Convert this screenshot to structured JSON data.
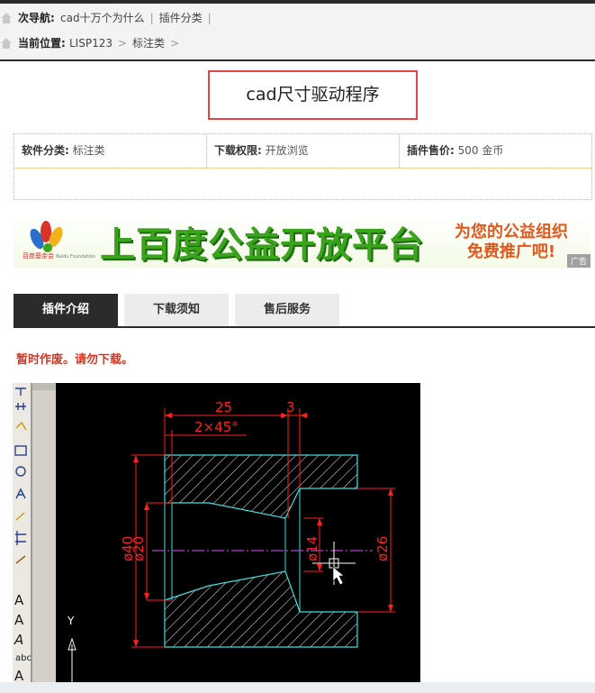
{
  "breadcrumb": {
    "sub_nav_label": "次导航:",
    "sub_nav_items": [
      "cad十万个为什么",
      "插件分类"
    ],
    "location_label": "当前位置:",
    "location_items": [
      "LISP123",
      "标注类"
    ]
  },
  "plugin": {
    "title": "cad尺寸驱动程序"
  },
  "info": {
    "category_label": "软件分类:",
    "category_value": "标注类",
    "permission_label": "下载权限:",
    "permission_value": "开放浏览",
    "price_label": "插件售价:",
    "price_value": "500 金币"
  },
  "banner": {
    "logo_text": "百度基金会",
    "logo_sub": "Baidu Foundation",
    "slogan": "上百度公益开放平台",
    "side_line1": "为您的公益组织",
    "side_line2": "免费推广吧!",
    "ad_tag": "广告"
  },
  "tabs": {
    "items": [
      "插件介绍",
      "下载须知",
      "售后服务"
    ],
    "active": 0
  },
  "notice": "暂时作废。请勿下载。",
  "cad": {
    "dim_25": "25",
    "dim_3": "3",
    "chamfer": "2×45°",
    "dia_40": "ø40",
    "dia_20": "ø20",
    "dia_14": "ø14",
    "dia_26": "ø26",
    "axis_y": "Y"
  }
}
